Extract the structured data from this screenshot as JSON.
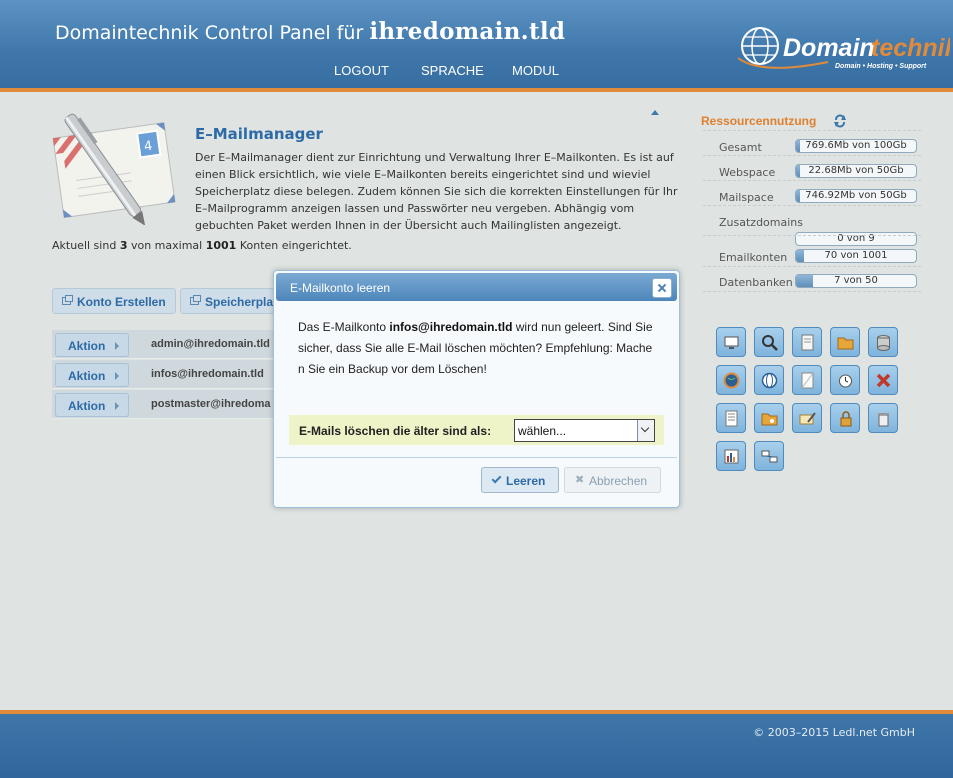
{
  "header": {
    "title_prefix": "Domaintechnik Control Panel für",
    "domain": "ihredomain.tld",
    "nav": {
      "logout": "LOGOUT",
      "sprache": "SPRACHE",
      "modul": "MODUL"
    },
    "logo": {
      "text_a": "Domain",
      "text_b": "technik",
      "tagline": "Domain  •  Hosting  •  Support"
    }
  },
  "section": {
    "title": "E–Mailmanager",
    "description": "Der E–Mailmanager dient zur Einrichtung und Verwaltung Ihrer E–Mailkonten. Es ist auf einen Blick ersichtlich, wie viele E–Mailkonten bereits eingerichtet sind und wieviel Speicherplatz diese belegen. Zudem können Sie sich die korrekten Einstellungen für Ihr E–Mailprogramm anzeigen lassen und Passwörter neu vergeben. Abhängig vom gebuchten Paket werden Ihnen in der Übersicht auch Mailinglisten angezeigt.",
    "count_pre": "Aktuell sind",
    "count_current": "3",
    "count_mid": "von maximal",
    "count_max": "1001",
    "count_post": "Konten eingerichtet."
  },
  "buttons": {
    "create": "Konto Erstellen",
    "storage": "Speicherpla"
  },
  "accounts": [
    {
      "action": "Aktion",
      "email": "admin@ihredomain.tld"
    },
    {
      "action": "Aktion",
      "email": "infos@ihredomain.tld"
    },
    {
      "action": "Aktion",
      "email": "postmaster@ihredoma"
    }
  ],
  "resources": {
    "title": "Ressourcennutzung",
    "rows": [
      {
        "label": "Gesamt",
        "value": "769.6Mb von 100Gb",
        "fill": 0.008
      },
      {
        "label": "Webspace",
        "value": "22.68Mb von 50Gb",
        "fill": 0.0005
      },
      {
        "label": "Mailspace",
        "value": "746.92Mb von 50Gb",
        "fill": 0.015
      },
      {
        "label": "Zusatzdomains",
        "value": "0 von 9",
        "fill": 0
      },
      {
        "label": "Emailkonten",
        "value": "70 von 1001",
        "fill": 0.07
      },
      {
        "label": "Datenbanken",
        "value": "7 von 50",
        "fill": 0.14
      }
    ]
  },
  "tools": [
    "monitor-icon",
    "search-person-icon",
    "document-icon",
    "folder-icon",
    "database-icon",
    "globe-icon",
    "world-settings-icon",
    "blank-page-icon",
    "clock-icon",
    "delete-icon",
    "text-document-icon",
    "folder-key-icon",
    "mail-edit-icon",
    "lock-user-icon",
    "trash-icon",
    "chart-icon",
    "network-icon"
  ],
  "modal": {
    "title": "E-Mailkonto leeren",
    "msg_pre": "Das E-Mailkonto",
    "msg_email": "infos@ihredomain.tld",
    "msg_post": "wird nun geleert. Sind Sie sicher, dass Sie alle E-Mail löschen möchten? Empfehlung: Machen Sie ein Backup vor dem Löschen!",
    "filter_label": "E-Mails löschen die älter sind als:",
    "select_value": "wählen...",
    "btn_confirm": "Leeren",
    "btn_cancel": "Abbrechen"
  },
  "footer": {
    "copyright": "© 2003–2015 Ledl.net GmbH"
  },
  "colors": {
    "header_blue": "#3f77ab",
    "accent_orange": "#e08a3a",
    "link_blue": "#2d6aa6"
  }
}
